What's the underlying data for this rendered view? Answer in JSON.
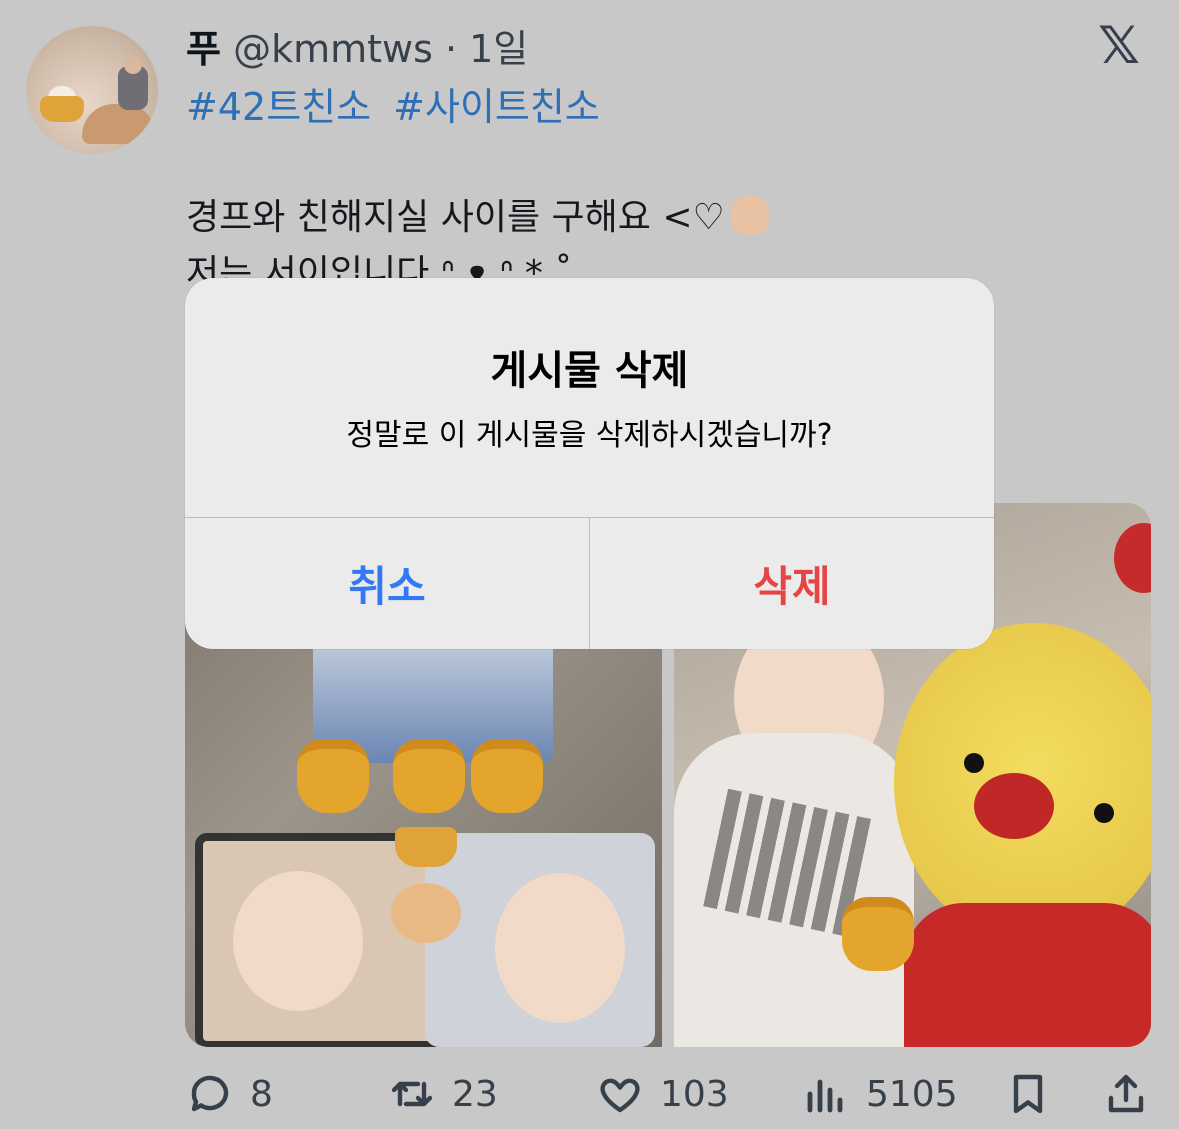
{
  "tweet": {
    "display_name": "푸",
    "handle_time": "@kmmtws · 1일",
    "hashtags": [
      "#42트친소",
      "#사이트친소"
    ],
    "text_line1": "경프와 친해지실 사이를 구해요 <♡",
    "text_line2": "저는 서이입니다 ᐢ.ᴥ.ᐢ *.˚"
  },
  "alert": {
    "title": "게시물 삭제",
    "message": "정말로 이 게시물을 삭제하시겠습니까?",
    "cancel_label": "취소",
    "delete_label": "삭제"
  },
  "actions": {
    "replies": "8",
    "retweets": "23",
    "likes": "103",
    "views": "5105"
  },
  "icons": {
    "brand": "x-logo-icon",
    "reply": "reply-icon",
    "retweet": "retweet-icon",
    "like": "heart-icon",
    "views": "views-icon",
    "bookmark": "bookmark-icon",
    "share": "share-icon"
  },
  "colors": {
    "hashtag": "#2e6fb6",
    "cancel": "#3478f6",
    "delete": "#e64545",
    "overlay_background": "#c8c8c8",
    "alert_background": "#ecebec"
  }
}
